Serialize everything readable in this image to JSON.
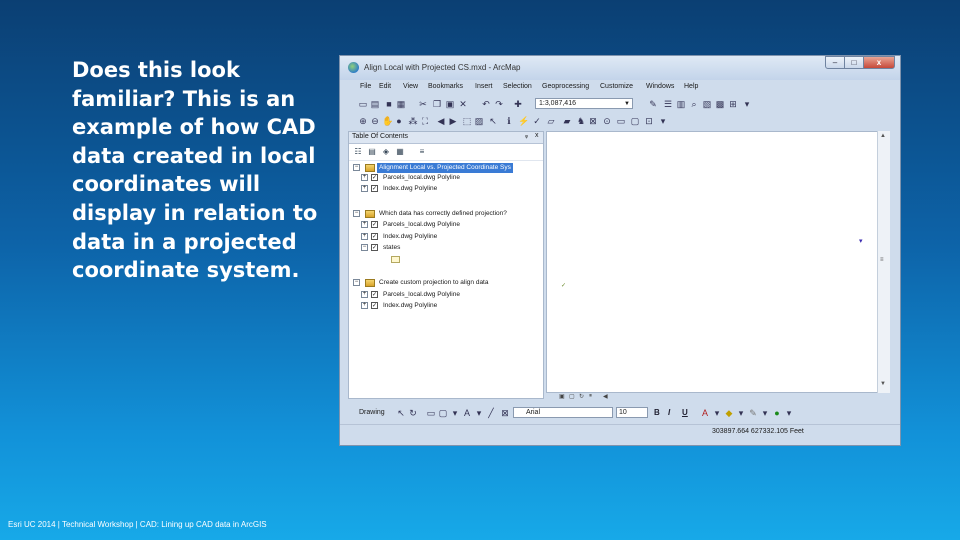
{
  "slide": {
    "lines": [
      "Does this look",
      "familiar?  This is an",
      "example of how CAD",
      "data created in local",
      "coordinates will",
      "display in relation to",
      "data in a  projected",
      "coordinate system."
    ],
    "footer": "Esri UC 2014 | Technical Workshop |   CAD: Lining up CAD data in ArcGIS"
  },
  "window": {
    "title": "Align Local with Projected CS.mxd - ArcMap",
    "controls": {
      "minimize": "–",
      "maximize": "□",
      "close": "x"
    },
    "menu": [
      "File",
      "Edit",
      "View",
      "Bookmarks",
      "Insert",
      "Selection",
      "Geoprocessing",
      "Customize",
      "Windows",
      "Help"
    ],
    "scale": "1:3,087,416",
    "toc": {
      "title": "Table Of Contents",
      "pin": "ᵩ",
      "close": "x",
      "frames": [
        {
          "name": "Alignment Local vs. Projected Coordinate Sys",
          "selected": true,
          "layers": [
            {
              "name": "Parcels_local.dwg Polyline",
              "checked": true
            },
            {
              "name": "Index.dwg Polyline",
              "checked": true
            }
          ]
        },
        {
          "name": "Which data has correctly defined projection?",
          "selected": false,
          "layers": [
            {
              "name": "Parcels_local.dwg Polyline",
              "checked": true
            },
            {
              "name": "Index.dwg Polyline",
              "checked": true
            },
            {
              "name": "states",
              "checked": true
            }
          ]
        },
        {
          "name": "Create custom projection to align data",
          "selected": false,
          "layers": [
            {
              "name": "Parcels_local.dwg Polyline",
              "checked": true
            },
            {
              "name": "Index.dwg Polyline",
              "checked": true
            }
          ]
        }
      ]
    },
    "draw_toolbar": {
      "label": "Drawing",
      "font": "Arial",
      "size": "10",
      "bold": "B",
      "italic": "I",
      "underline": "U"
    },
    "status": {
      "coordinates": "303897.664  627332.105 Feet"
    },
    "colors": {
      "selection": "#3a7bd5",
      "window_bg": "#cfdcec",
      "slide_bg_top": "#0b3f73",
      "slide_bg_bottom": "#17a9e8"
    }
  }
}
